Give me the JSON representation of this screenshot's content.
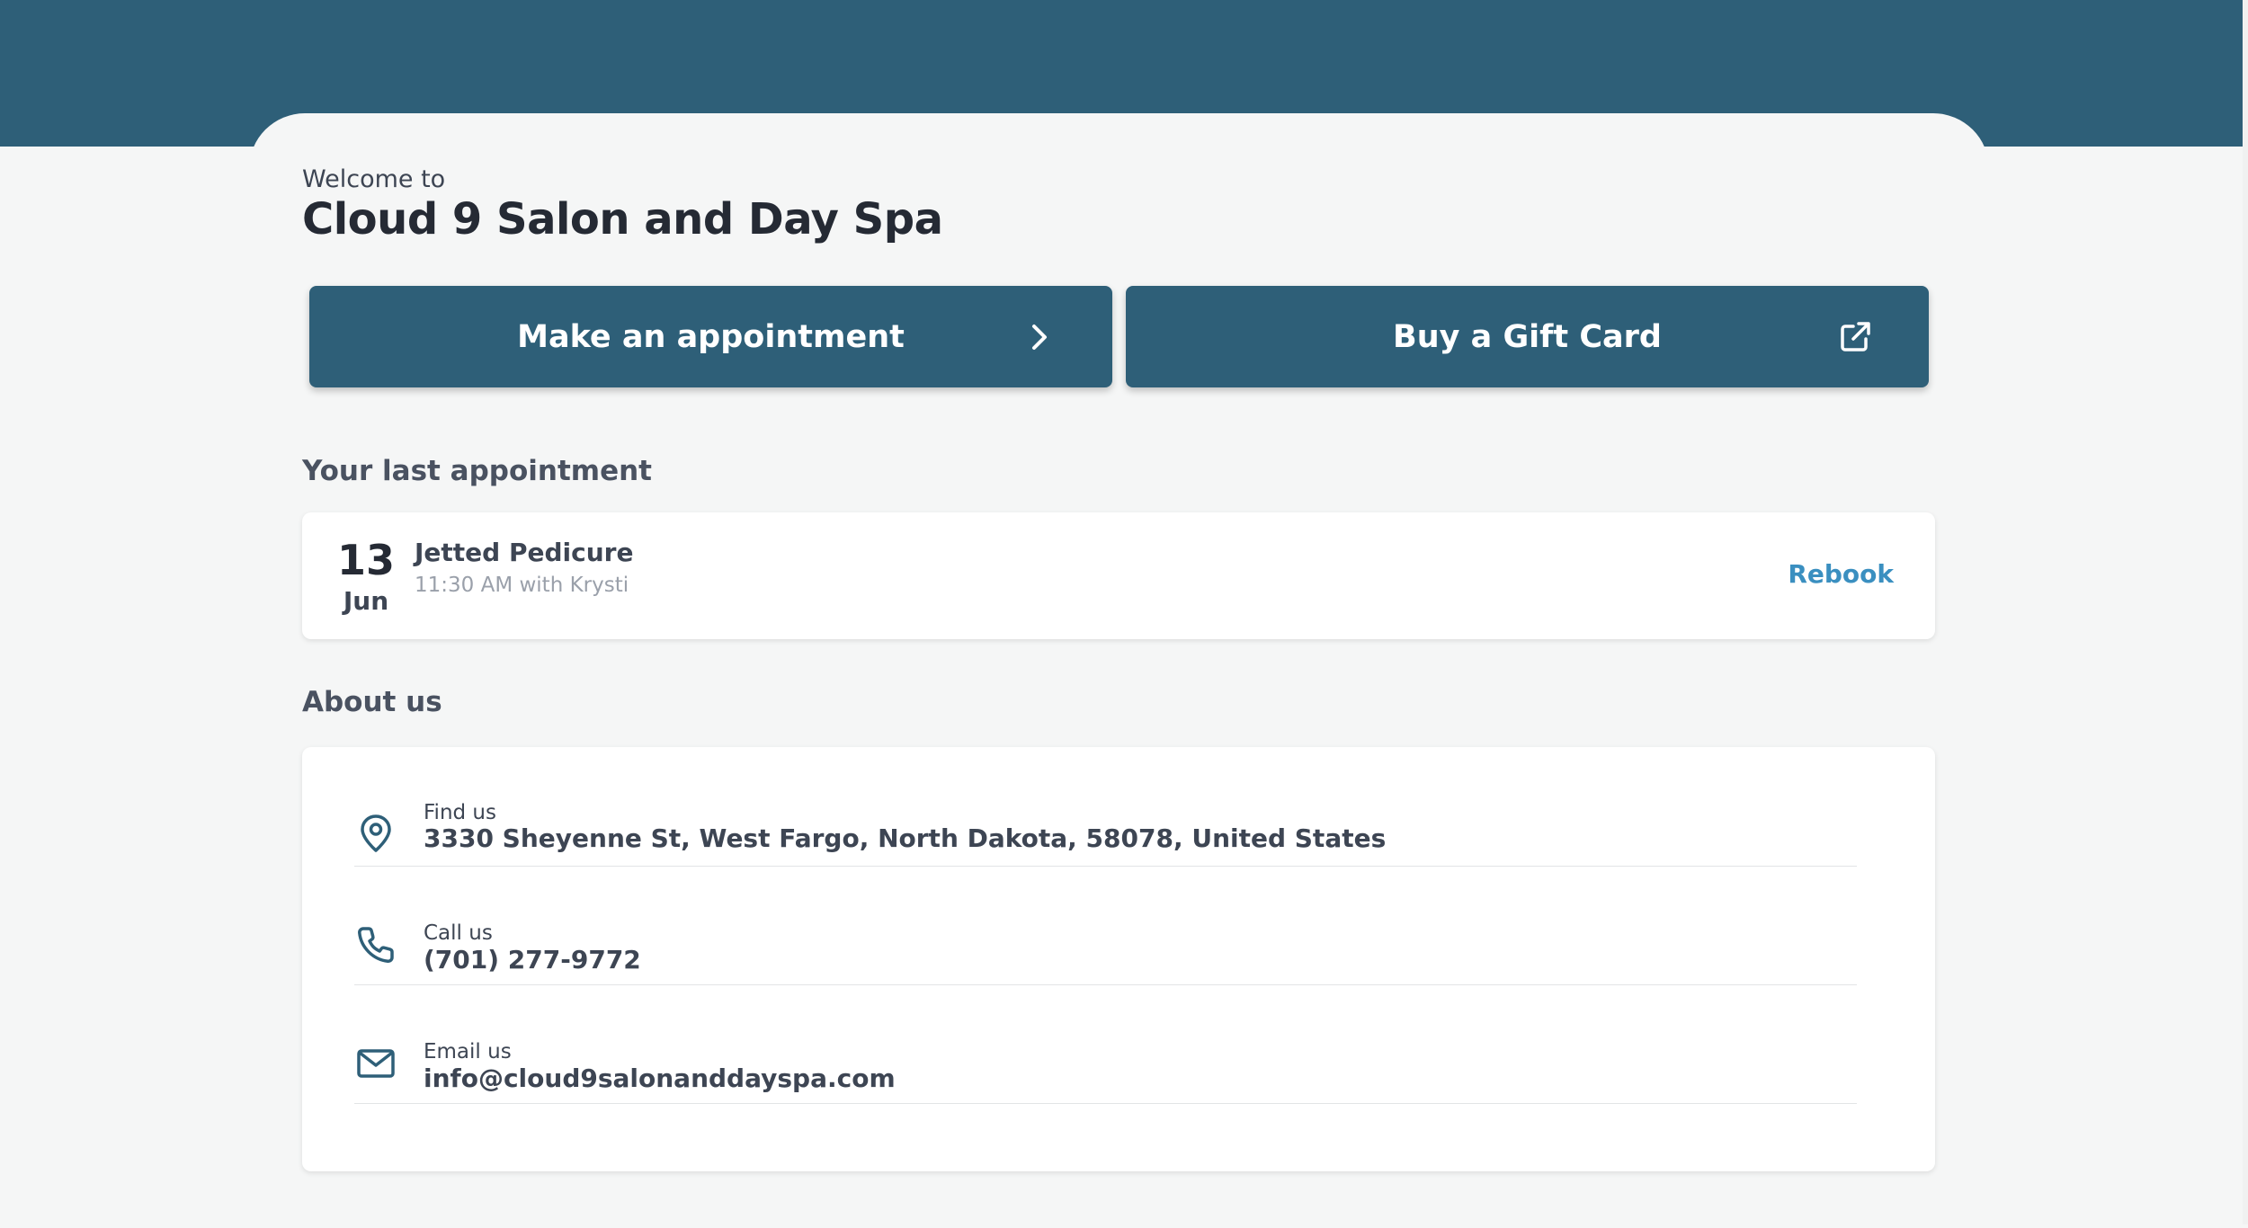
{
  "header": {
    "welcome_text": "Welcome to",
    "business_name": "Cloud 9 Salon and Day Spa"
  },
  "actions": {
    "appointment_label": "Make an appointment",
    "appointment_icon": "chevron-right-icon",
    "gift_card_label": "Buy a Gift Card",
    "gift_card_icon": "external-link-icon"
  },
  "last_appointment": {
    "heading": "Your last appointment",
    "day": "13",
    "month": "Jun",
    "service": "Jetted Pedicure",
    "detail": "11:30 AM with Krysti",
    "rebook_label": "Rebook"
  },
  "about": {
    "heading": "About us",
    "items": [
      {
        "icon": "map-pin-icon",
        "label": "Find us",
        "value": "3330 Sheyenne St, West Fargo, North Dakota, 58078, United States"
      },
      {
        "icon": "phone-icon",
        "label": "Call us",
        "value": "(701) 277-9772"
      },
      {
        "icon": "mail-icon",
        "label": "Email us",
        "value": "info@cloud9salonanddayspa.com"
      }
    ]
  },
  "colors": {
    "brand": "#2e5f78",
    "link": "#3a8fc0",
    "background": "#f5f6f6",
    "card": "#ffffff"
  }
}
